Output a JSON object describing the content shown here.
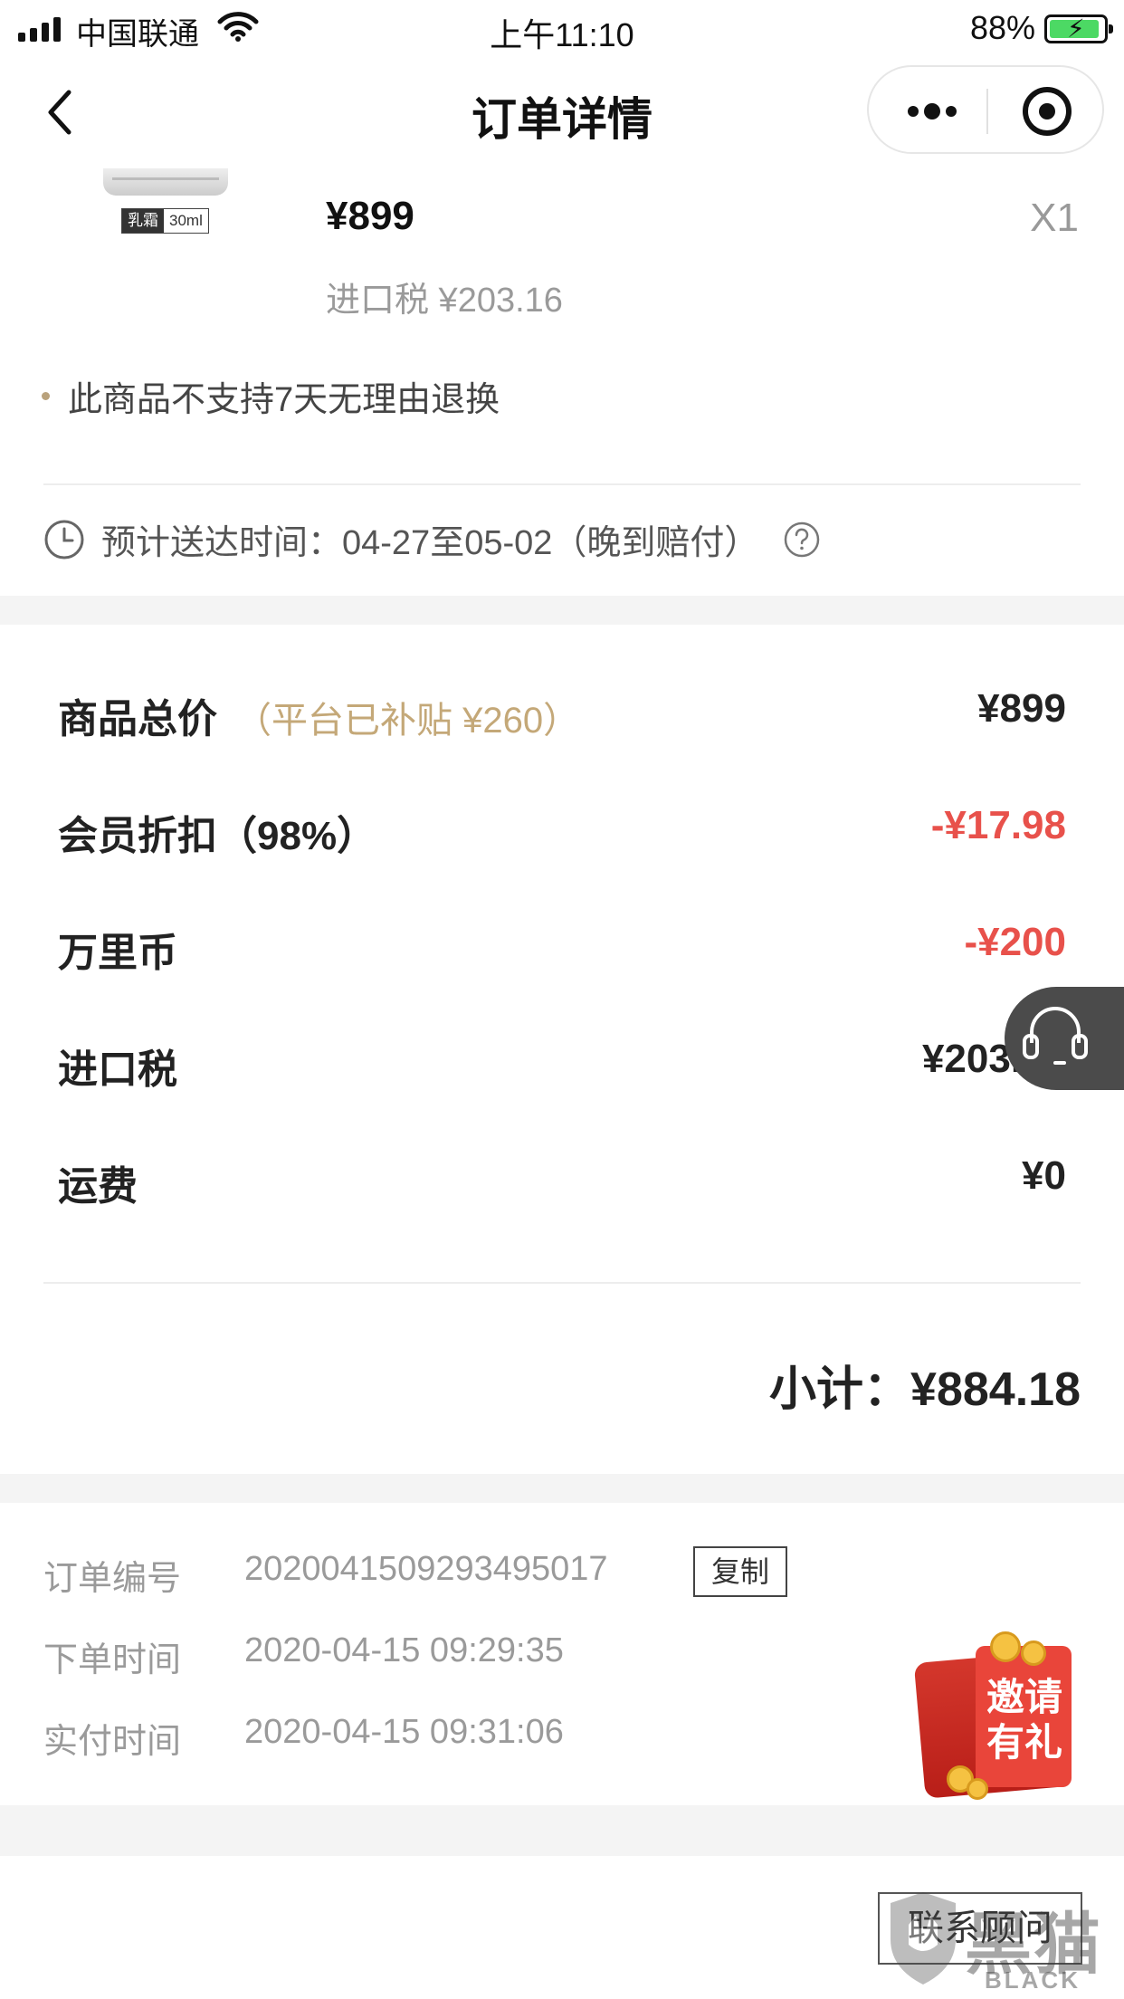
{
  "status_bar": {
    "carrier": "中国联通",
    "time": "上午11:10",
    "battery": "88%",
    "battery_level": 0.88
  },
  "nav": {
    "title": "订单详情",
    "back_icon": "chevron-left-icon",
    "more_icon": "more-dots-icon",
    "close_icon": "target-circle-icon"
  },
  "product": {
    "thumb_label_left": "乳霜",
    "thumb_label_right": "30ml",
    "price": "¥899",
    "quantity": "X1",
    "tax": "进口税 ¥203.16",
    "notice": "此商品不支持7天无理由退换"
  },
  "delivery": {
    "text": "预计送达时间：04-27至05-02（晚到赔付）"
  },
  "breakdown": [
    {
      "label": "商品总价",
      "sub": "（平台已补贴 ¥260）",
      "value": "¥899",
      "discount": false
    },
    {
      "label": "会员折扣（98%）",
      "sub": "",
      "value": "-¥17.98",
      "discount": true
    },
    {
      "label": "万里币",
      "sub": "",
      "value": "-¥200",
      "discount": true
    },
    {
      "label": "进口税",
      "sub": "",
      "value": "¥203.16",
      "discount": false
    },
    {
      "label": "运费",
      "sub": "",
      "value": "¥0",
      "discount": false
    }
  ],
  "subtotal": "小计：¥884.18",
  "order_info": {
    "order_no_label": "订单编号",
    "order_no": "2020041509293495017",
    "copy_label": "复制",
    "placed_label": "下单时间",
    "placed": "2020-04-15 09:29:35",
    "paid_label": "实付时间",
    "paid": "2020-04-15 09:31:06"
  },
  "invite": {
    "text_line1": "邀请",
    "text_line2": "有礼"
  },
  "contact_label": "联系顾问",
  "watermark": {
    "cn": "黑猫",
    "en": "BLACK CAT"
  },
  "colors": {
    "accent_gold": "#c4a878",
    "discount_red": "#e8514b",
    "battery_green": "#4cd964"
  }
}
